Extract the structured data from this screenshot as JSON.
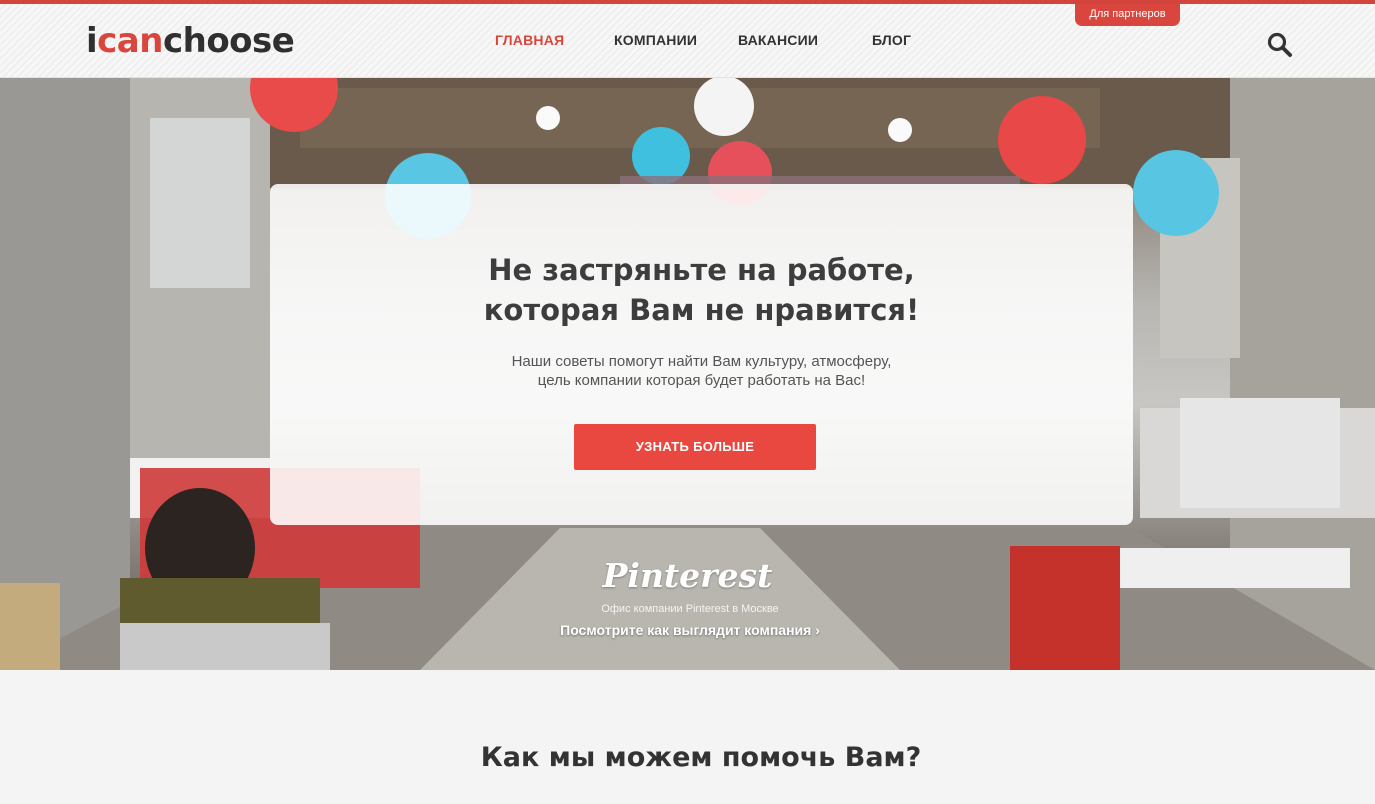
{
  "header": {
    "logo": {
      "part1": "i",
      "part2": "can",
      "part3": "choose"
    },
    "partners_tab": "Для партнеров",
    "nav": [
      {
        "label": "ГЛАВНАЯ",
        "active": true
      },
      {
        "label": "КОМПАНИИ",
        "active": false
      },
      {
        "label": "ВАКАНСИИ",
        "active": false
      },
      {
        "label": "БЛОГ",
        "active": false
      }
    ],
    "search_icon": "search-icon"
  },
  "hero": {
    "title_line1": "Не застряньте на работе,",
    "title_line2": "которая Вам не нравится!",
    "subtitle_line1": "Наши советы помогут найти Вам культуру, атмосферу,",
    "subtitle_line2": "цель компании которая будет работать на Вас!",
    "cta_label": "УЗНАТЬ БОЛЬШЕ",
    "company_logo_text": "Pinterest",
    "company_caption": "Офис компании Pinterest в Москве",
    "company_link": "Посмотрите как выглядит компания  ›"
  },
  "section": {
    "title": "Как мы можем помочь Вам?"
  },
  "colors": {
    "accent": "#d9463d",
    "button": "#e8483f"
  }
}
